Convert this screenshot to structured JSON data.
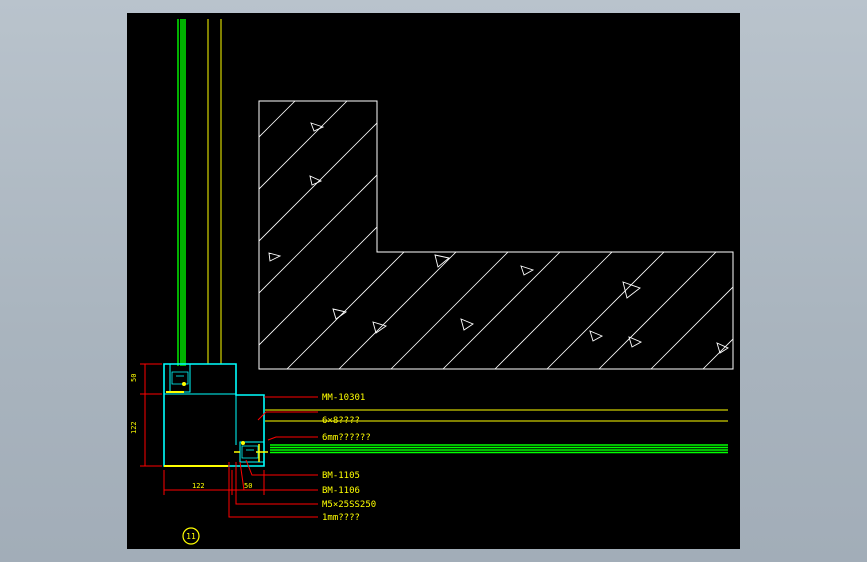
{
  "colors": {
    "background": "#000000",
    "concrete_outline": "#ffffff",
    "hatch": "#ffffff",
    "mullion": "#00ffff",
    "glass": "#00ff00",
    "sealant": "#ffff00",
    "leader": "#ff0000",
    "label_text": "#ffff00"
  },
  "callouts": {
    "mm_10301": "MM-10301",
    "screw_6x8": "6×8????",
    "glass_6mm": "6mm??????",
    "bm_1105": "BM-1105",
    "bm_1106": "BM-1106",
    "m5_bolt": "M5×25SS250",
    "gasket_1mm": "1mm????"
  },
  "dimensions": {
    "vertical_top": "50",
    "vertical_main": "122",
    "horizontal_main": "122",
    "horizontal_small": "50"
  },
  "detail": {
    "number": "11"
  }
}
